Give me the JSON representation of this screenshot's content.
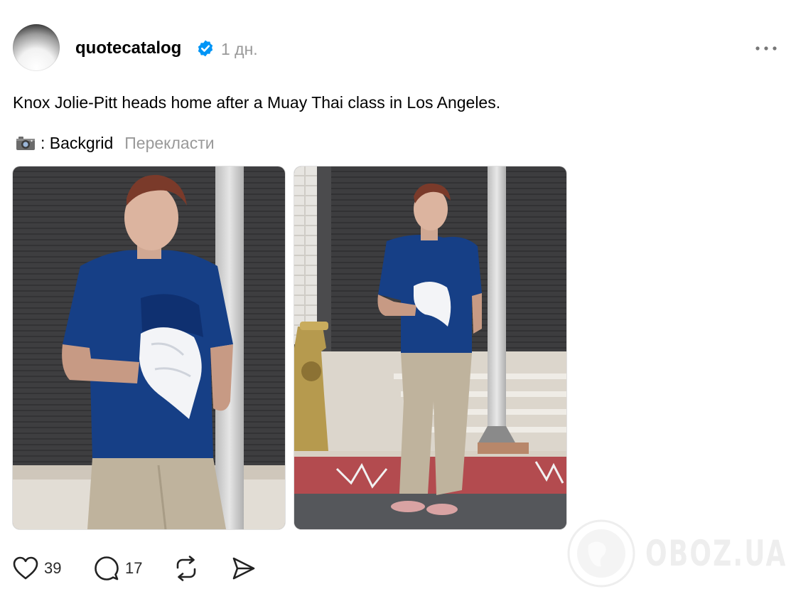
{
  "post": {
    "author": {
      "username": "quotecatalog",
      "verified": true,
      "avatar": "avatar-image"
    },
    "timestamp": "1 дн.",
    "more_icon": "more-horizontal-icon",
    "caption": "Knox Jolie-Pitt heads home after a Muay Thai class in Los Angeles.",
    "credit": {
      "icon": "camera-icon",
      "text": ": Backgrid"
    },
    "translate_label": "Перекласти",
    "images": [
      {
        "alt": "photo-1"
      },
      {
        "alt": "photo-2"
      }
    ],
    "actions": {
      "like": {
        "icon": "heart-icon",
        "count": "39"
      },
      "reply": {
        "icon": "comment-icon",
        "count": "17"
      },
      "repost": {
        "icon": "repost-icon"
      },
      "share": {
        "icon": "send-icon"
      }
    }
  },
  "watermark": {
    "text": "OBOZ.UA"
  },
  "colors": {
    "verified_blue": "#0095F6",
    "secondary_text": "#999999",
    "tshirt_blue": "#12408a",
    "pants_beige": "#bfb39d"
  }
}
